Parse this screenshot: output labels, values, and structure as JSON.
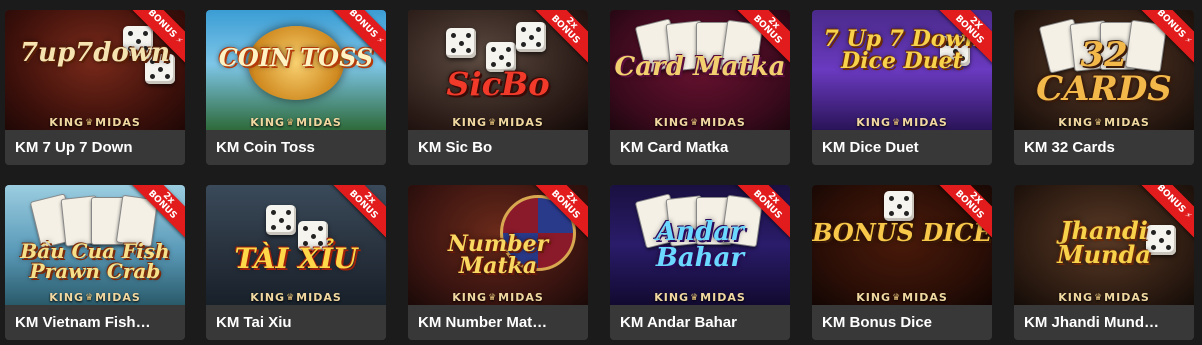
{
  "games": [
    {
      "title": "KM 7 Up 7 Down",
      "art_text": "7up7down",
      "badge": {
        "type": "bolt",
        "text": "BONUS"
      },
      "brand": "KING MIDAS",
      "art_icon": "dice-icon"
    },
    {
      "title": "KM Coin Toss",
      "art_text": "COIN TOSS",
      "badge": {
        "type": "bolt",
        "text": "BONUS"
      },
      "brand": "KING MIDAS",
      "art_icon": "coin-icon"
    },
    {
      "title": "KM Sic Bo",
      "art_text": "SicBo",
      "badge": {
        "type": "multiplier",
        "multiplier": "2x",
        "text": "BONUS"
      },
      "brand": "KING MIDAS",
      "art_icon": "dice-icon"
    },
    {
      "title": "KM Card Matka",
      "art_text": "Card Matka",
      "badge": {
        "type": "multiplier",
        "multiplier": "2x",
        "text": "BONUS"
      },
      "brand": "KING MIDAS",
      "art_icon": "cards-icon"
    },
    {
      "title": "KM Dice Duet",
      "art_text": "7 Up 7 Down Dice Duet",
      "badge": {
        "type": "multiplier",
        "multiplier": "2X",
        "text": "BONUS"
      },
      "brand": "KING MIDAS",
      "art_icon": "dice-icon"
    },
    {
      "title": "KM 32 Cards",
      "art_text": "32 CARDS",
      "badge": {
        "type": "bolt",
        "text": "BONUS"
      },
      "brand": "KING MIDAS",
      "art_icon": "cards-icon"
    },
    {
      "title": "KM Vietnam Fish…",
      "art_text": "Bầu Cua Fish Prawn Crab",
      "badge": {
        "type": "multiplier",
        "multiplier": "2x",
        "text": "BONUS"
      },
      "brand": "KING MIDAS",
      "art_icon": "crab-icon"
    },
    {
      "title": "KM Tai Xiu",
      "art_text": "TÀI XỈU",
      "badge": {
        "type": "multiplier",
        "multiplier": "2x",
        "text": "BONUS"
      },
      "brand": "KING MIDAS",
      "art_icon": "dice-icon"
    },
    {
      "title": "KM Number Mat…",
      "art_text": "Number Matka",
      "badge": {
        "type": "multiplier",
        "multiplier": "2x",
        "text": "BONUS"
      },
      "brand": "KING MIDAS",
      "art_icon": "wheel-icon"
    },
    {
      "title": "KM Andar Bahar",
      "art_text": "Andar Bahar",
      "badge": {
        "type": "multiplier",
        "multiplier": "2x",
        "text": "BONUS"
      },
      "brand": "KING MIDAS",
      "art_icon": "cards-icon"
    },
    {
      "title": "KM Bonus Dice",
      "art_text": "BONUS DICE",
      "badge": {
        "type": "multiplier",
        "multiplier": "2X",
        "text": "BONUS"
      },
      "brand": "KING MIDAS",
      "art_icon": "dice-icon"
    },
    {
      "title": "KM Jhandi Mund…",
      "art_text": "Jhandi Munda",
      "badge": {
        "type": "bolt",
        "text": "BONUS"
      },
      "brand": "KING MIDAS",
      "art_icon": "dice-icon"
    }
  ],
  "colors": {
    "page_bg": "#1b1b1b",
    "card_bg": "#383838",
    "title_text": "#ffffff",
    "ribbon": "#e21c1c",
    "brand_text": "#f0d8a0"
  }
}
